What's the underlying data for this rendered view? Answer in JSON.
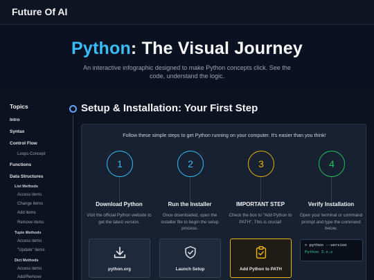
{
  "app": {
    "brand": "Future Of AI"
  },
  "hero": {
    "title_accent": "Python",
    "title_rest": ": The Visual Journey",
    "subtitle": "An interactive infographic designed to make Python concepts click. See the code, understand the logic."
  },
  "sidebar": {
    "heading": "Topics",
    "items": [
      {
        "label": "Intro",
        "level": 1
      },
      {
        "label": "Syntax",
        "level": 1
      },
      {
        "label": "Control Flow",
        "level": 1
      },
      {
        "label": "Loops Concept",
        "level": 3
      },
      {
        "label": "Functions",
        "level": 1
      },
      {
        "label": "Data Structures",
        "level": 1
      },
      {
        "label": "List Methods",
        "level": 2
      },
      {
        "label": "Access items",
        "level": 3
      },
      {
        "label": "Change items",
        "level": 3
      },
      {
        "label": "Add items",
        "level": 3
      },
      {
        "label": "Remove items",
        "level": 3
      },
      {
        "label": "Tuple Methods",
        "level": 2
      },
      {
        "label": "Access items",
        "level": 3
      },
      {
        "label": "\"Update\" items",
        "level": 3
      },
      {
        "label": "Dict Methods",
        "level": 2
      },
      {
        "label": "Access items",
        "level": 3
      },
      {
        "label": "Add/Remove",
        "level": 3
      }
    ]
  },
  "section": {
    "title": "Setup & Installation: Your First Step",
    "intro": "Follow these simple steps to get Python running on your computer. It's easier than you think!",
    "steps": [
      {
        "number": "1",
        "title": "Download Python",
        "desc": "Visit the official Python website to get the latest version.",
        "color": "#38bdf8",
        "action": "python.org"
      },
      {
        "number": "2",
        "title": "Run the Installer",
        "desc": "Once downloaded, open the installer file to begin the setup process.",
        "color": "#38bdf8",
        "action": "Launch Setup"
      },
      {
        "number": "3",
        "title": "IMPORTANT STEP",
        "desc": "Check the box to \"Add Python to PATH\". This is crucial!",
        "color": "#eab308",
        "action": "Add Python to PATH"
      },
      {
        "number": "4",
        "title": "Verify Installation",
        "desc": "Open your terminal or command prompt and type the command below.",
        "color": "#22c55e"
      }
    ],
    "terminal": {
      "command": "> python --version",
      "output": "Python 3.x.x"
    }
  }
}
